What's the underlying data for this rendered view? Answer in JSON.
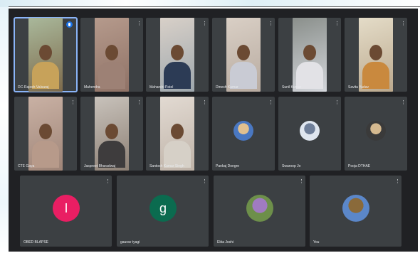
{
  "meeting": {
    "participants": [
      {
        "name": "DC-Rajesh Valsaraj",
        "kind": "video",
        "colors": [
          "#a9b89b",
          "#7d6a4b"
        ],
        "shirt": "#c7a25a",
        "speaking": true
      },
      {
        "name": "Mahendra",
        "kind": "video",
        "colors": [
          "#b59a8c",
          "#8f7266"
        ],
        "shirt": "#9d8175"
      },
      {
        "name": "Maharshi Patel",
        "kind": "video",
        "colors": [
          "#d8d0c8",
          "#9ea7ad"
        ],
        "shirt": "#2c3b55"
      },
      {
        "name": "Dinesh Kumar",
        "kind": "video",
        "colors": [
          "#d9cfc5",
          "#b8aba0"
        ],
        "shirt": "#c9cbd4"
      },
      {
        "name": "Sunil Kumar",
        "kind": "video",
        "colors": [
          "#8a8f8b",
          "#d4d7dc"
        ],
        "shirt": "#e2e2e6"
      },
      {
        "name": "Savita Yadav",
        "kind": "video",
        "colors": [
          "#e4dcc8",
          "#bba98e"
        ],
        "shirt": "#c9893e"
      },
      {
        "name": "CTE Gaya",
        "kind": "video",
        "colors": [
          "#c9b1a4",
          "#9f8578"
        ],
        "shirt": "#b79a8a"
      },
      {
        "name": "Jaspreet Bharadwaj",
        "kind": "video",
        "colors": [
          "#c8c2bb",
          "#8d8075"
        ],
        "shirt": "#3e3c3d"
      },
      {
        "name": "Santosh Kumar Singh",
        "kind": "video",
        "colors": [
          "#e2dad2",
          "#bfb3a8"
        ],
        "shirt": "#d6d0c7"
      },
      {
        "name": "Pankaj Dongre",
        "kind": "photo",
        "photo_colors": [
          "#4a78c2",
          "#e1c08f"
        ]
      },
      {
        "name": "Swaroop Jo",
        "kind": "photo",
        "photo_colors": [
          "#dfe6ef",
          "#6f7f99"
        ]
      },
      {
        "name": "Pooja DTHAE",
        "kind": "photo",
        "photo_colors": [
          "#3a3a3a",
          "#d5b98f"
        ]
      },
      {
        "name": "OBED BLAPSE",
        "kind": "letter",
        "letter": "I",
        "avatar_color": "#e91e63"
      },
      {
        "name": "gaurav tyagi",
        "kind": "letter",
        "letter": "g",
        "avatar_color": "#0b6b4f"
      },
      {
        "name": "Ekta Joshi",
        "kind": "photo",
        "photo_colors": [
          "#6d8f4a",
          "#a07bc0"
        ]
      },
      {
        "name": "You",
        "kind": "photo",
        "photo_colors": [
          "#5b87c9",
          "#8a6a3a"
        ]
      }
    ],
    "menu_icon": "more-vert-icon",
    "mic_icon": "mic-active-icon"
  }
}
